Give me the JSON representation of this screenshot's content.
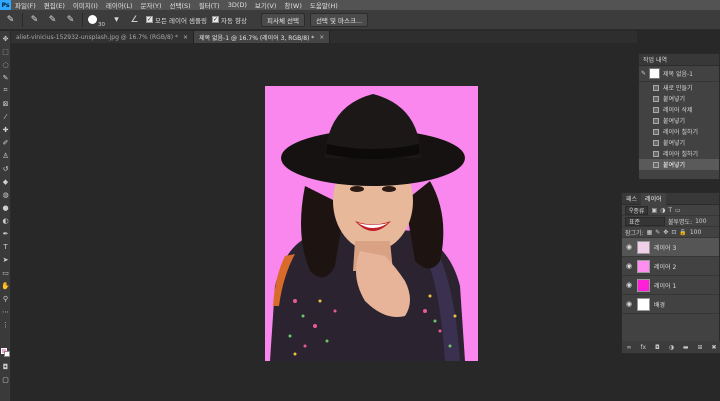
{
  "menu": {
    "items": [
      "파일(F)",
      "편집(E)",
      "이미지(I)",
      "레이어(L)",
      "문자(Y)",
      "선택(S)",
      "필터(T)",
      "3D(D)",
      "보기(V)",
      "창(W)",
      "도움말(H)"
    ]
  },
  "options": {
    "brush_size": "30",
    "sample_all_layers": "모든 레이어 샘플링",
    "auto_enhance": "자동 향상",
    "select_subject": "피사체 선택",
    "select_mask": "선택 및 마스크..."
  },
  "tabs": [
    {
      "label": "aliet-vinicius-152932-unsplash.jpg @ 16.7% (RGB/8) *",
      "active": false
    },
    {
      "label": "제목 없음-1 @ 16.7% (레이어 3, RGB/8) *",
      "active": true
    }
  ],
  "history": {
    "title": "작업 내역",
    "snapshot": "제목 없음-1",
    "items": [
      "새로 만들기",
      "붙여넣기",
      "레이어 삭제",
      "붙여넣기",
      "레이어 칠하기",
      "붙여넣기",
      "레이어 칠하기",
      "붙여넣기"
    ],
    "selected_index": 7
  },
  "layers": {
    "tabs": [
      "패스",
      "레이어"
    ],
    "filter": "종류",
    "blend_mode": "표준",
    "opacity_label": "불투명도:",
    "opacity_value": "100",
    "lock_label": "잠그기:",
    "fill_value": "100",
    "items": [
      {
        "name": "레이어 3",
        "thumb": "#f0d0e8",
        "selected": true
      },
      {
        "name": "레이어 2",
        "thumb": "#ff8ef0",
        "selected": false
      },
      {
        "name": "레이어 1",
        "thumb": "#ff1fd6",
        "selected": false
      },
      {
        "name": "배경",
        "thumb": "#ffffff",
        "selected": false
      }
    ]
  },
  "colors": {
    "canvas_bg": "#f987ed",
    "foreground": "#f0a8d8",
    "background": "#ffffff"
  }
}
